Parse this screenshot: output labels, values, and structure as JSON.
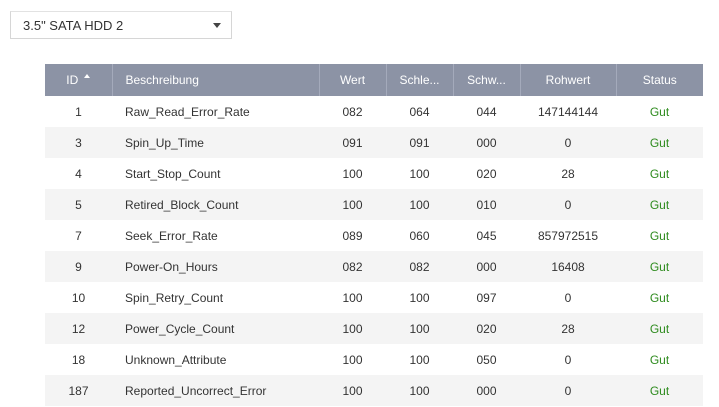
{
  "disk_selector": {
    "selected": "3.5\" SATA HDD 2",
    "caret_icon": "chevron-down-icon"
  },
  "table": {
    "columns": [
      {
        "key": "id",
        "label": "ID",
        "sorted": "ascending"
      },
      {
        "key": "description",
        "label": "Beschreibung"
      },
      {
        "key": "value",
        "label": "Wert"
      },
      {
        "key": "threshold",
        "label": "Schle..."
      },
      {
        "key": "worst",
        "label": "Schw..."
      },
      {
        "key": "raw",
        "label": "Rohwert"
      },
      {
        "key": "status",
        "label": "Status"
      }
    ],
    "rows": [
      {
        "id": "1",
        "description": "Raw_Read_Error_Rate",
        "value": "082",
        "threshold": "064",
        "worst": "044",
        "raw": "147144144",
        "status": "Gut"
      },
      {
        "id": "3",
        "description": "Spin_Up_Time",
        "value": "091",
        "threshold": "091",
        "worst": "000",
        "raw": "0",
        "status": "Gut"
      },
      {
        "id": "4",
        "description": "Start_Stop_Count",
        "value": "100",
        "threshold": "100",
        "worst": "020",
        "raw": "28",
        "status": "Gut"
      },
      {
        "id": "5",
        "description": "Retired_Block_Count",
        "value": "100",
        "threshold": "100",
        "worst": "010",
        "raw": "0",
        "status": "Gut"
      },
      {
        "id": "7",
        "description": "Seek_Error_Rate",
        "value": "089",
        "threshold": "060",
        "worst": "045",
        "raw": "857972515",
        "status": "Gut"
      },
      {
        "id": "9",
        "description": "Power-On_Hours",
        "value": "082",
        "threshold": "082",
        "worst": "000",
        "raw": "16408",
        "status": "Gut"
      },
      {
        "id": "10",
        "description": "Spin_Retry_Count",
        "value": "100",
        "threshold": "100",
        "worst": "097",
        "raw": "0",
        "status": "Gut"
      },
      {
        "id": "12",
        "description": "Power_Cycle_Count",
        "value": "100",
        "threshold": "100",
        "worst": "020",
        "raw": "28",
        "status": "Gut"
      },
      {
        "id": "18",
        "description": "Unknown_Attribute",
        "value": "100",
        "threshold": "100",
        "worst": "050",
        "raw": "0",
        "status": "Gut"
      },
      {
        "id": "187",
        "description": "Reported_Uncorrect_Error",
        "value": "100",
        "threshold": "100",
        "worst": "000",
        "raw": "0",
        "status": "Gut"
      }
    ]
  },
  "colors": {
    "header_bg": "#8c93a5",
    "status_good": "#2e8b1e",
    "row_alt": "#f4f4f4"
  }
}
